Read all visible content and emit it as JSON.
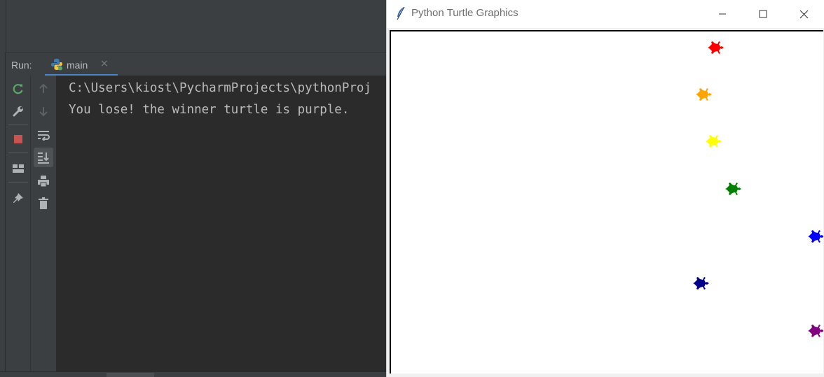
{
  "ide": {
    "run_label": "Run:",
    "run_tab": {
      "label": "main",
      "close_glyph": "×"
    },
    "console_lines": [
      "C:\\Users\\kiost\\PycharmProjects\\pythonProj",
      "You lose! the winner turtle is purple."
    ],
    "toolbar_left": [
      "rerun-icon",
      "wrench-icon",
      "stop-icon",
      "layout-icon",
      "pin-icon"
    ],
    "toolbar_right": [
      "arrow-up-icon",
      "arrow-down-icon",
      "soft-wrap-icon",
      "scroll-to-end-icon",
      "print-icon",
      "trash-icon"
    ],
    "colors": {
      "console_bg": "#2b2b2b",
      "panel_bg": "#3c3f41",
      "text": "#bbbbbb",
      "accent": "#4a88c7",
      "rerun": "#59a869",
      "stop": "#c75450"
    }
  },
  "turtle_window": {
    "title": "Python Turtle Graphics",
    "controls": [
      "minimize-icon",
      "maximize-icon",
      "close-icon"
    ],
    "turtles": [
      {
        "color": "red"
      },
      {
        "color": "orange"
      },
      {
        "color": "yellow"
      },
      {
        "color": "green"
      },
      {
        "color": "blue"
      },
      {
        "color": "darkblue"
      },
      {
        "color": "purple"
      }
    ]
  }
}
